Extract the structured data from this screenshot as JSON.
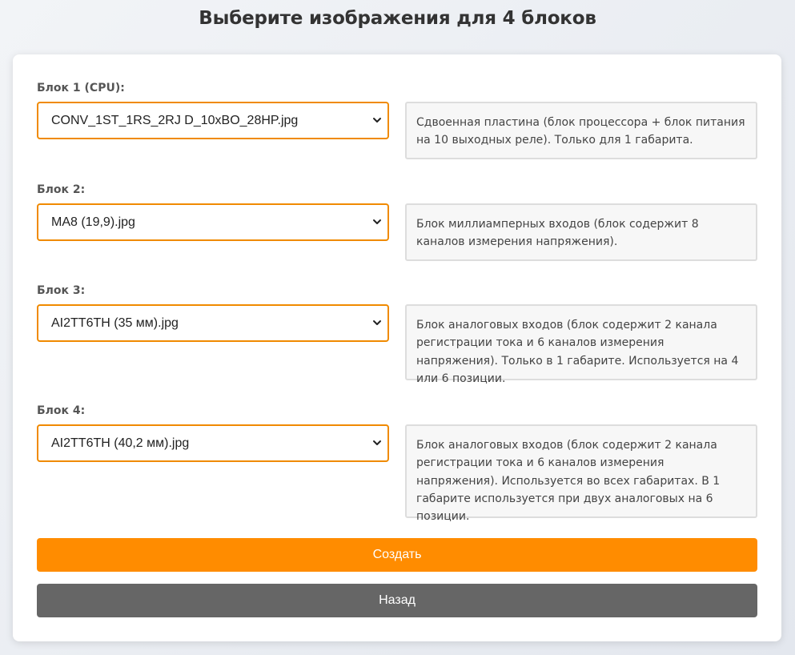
{
  "page": {
    "title": "Выберите изображения для 4 блоков"
  },
  "blocks": [
    {
      "label": "Блок 1 (CPU):",
      "selected": "CONV_1ST_1RS_2RJ D_10xBO_28HP.jpg",
      "description": "Сдвоенная пластина (блок процессора + блок питания на 10 выходных реле). Только для 1 габарита."
    },
    {
      "label": "Блок 2:",
      "selected": "MA8 (19,9).jpg",
      "description": "Блок миллиамперных входов (блок содержит 8 каналов измерения напряжения)."
    },
    {
      "label": "Блок 3:",
      "selected": "AI2TT6TH (35 мм).jpg",
      "description": "Блок аналоговых входов (блок содержит 2 канала регистрации тока и 6 каналов измерения напряжения). Только в 1 габарите. Используется на 4 или 6 позиции."
    },
    {
      "label": "Блок 4:",
      "selected": "AI2TT6TH (40,2 мм).jpg",
      "description": "Блок аналоговых входов (блок содержит 2 канала регистрации тока и 6 каналов измерения напряжения). Используется во всех габаритах. В 1 габарите используется при двух аналоговых на 6 позиции."
    }
  ],
  "buttons": {
    "create_label": "Создать",
    "back_label": "Назад"
  },
  "icons": {
    "dropdown": "chevron-down-icon"
  },
  "colors": {
    "accent": "#ff8c00",
    "select_border": "#f08a00",
    "secondary_button": "#666666"
  }
}
